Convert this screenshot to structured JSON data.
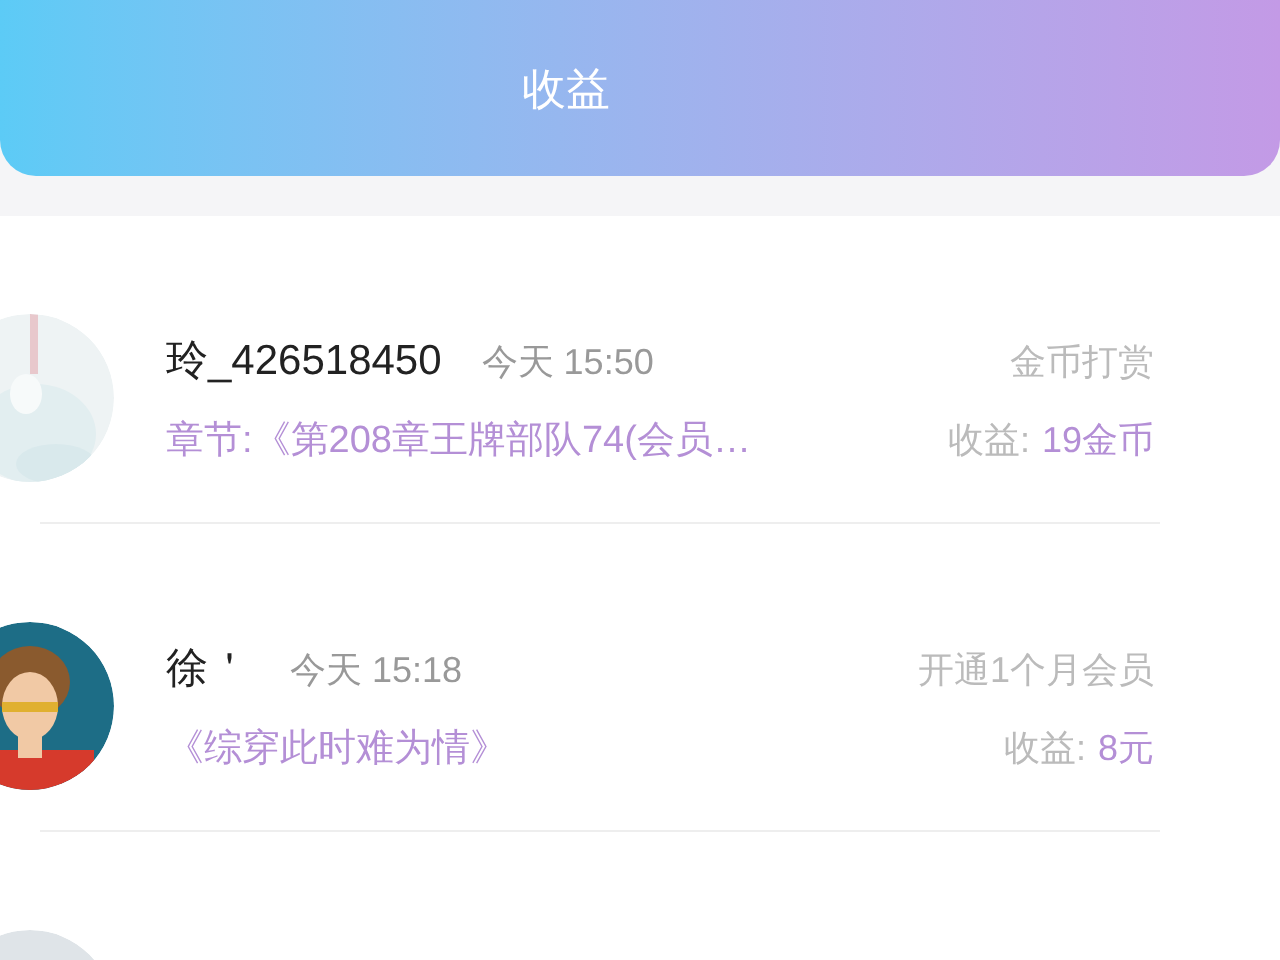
{
  "header": {
    "title": "收益"
  },
  "records": [
    {
      "avatar": {
        "kind": "picture"
      },
      "name": "玲_426518450",
      "time": "今天 15:50",
      "type": "金币打赏",
      "content": "章节:《第208章王牌部队74(会员…",
      "earning_label": "收益:",
      "earning_value": "19金币"
    },
    {
      "avatar": {
        "kind": "picture"
      },
      "name": "徐＇",
      "time": "今天 15:18",
      "type": "开通1个月会员",
      "content": "《综穿此时难为情》",
      "earning_label": "收益:",
      "earning_value": "8元"
    },
    {
      "avatar": {
        "kind": "picture"
      }
    }
  ]
}
